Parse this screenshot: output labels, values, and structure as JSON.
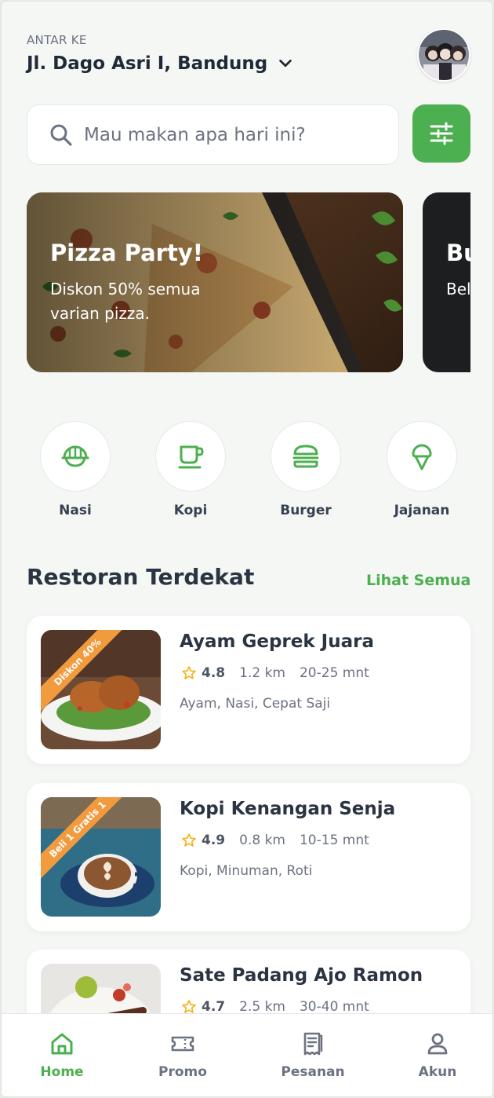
{
  "header": {
    "deliver_label": "ANTAR KE",
    "address": "Jl. Dago Asri I, Bandung"
  },
  "search": {
    "placeholder": "Mau makan apa hari ini?"
  },
  "banners": [
    {
      "title": "Pizza Party!",
      "description": "Diskon 50% semua varian pizza."
    },
    {
      "title": "Bu",
      "description": "Bel Bur"
    }
  ],
  "categories": [
    {
      "label": "Nasi",
      "icon": "rice-bowl-icon"
    },
    {
      "label": "Kopi",
      "icon": "coffee-cup-icon"
    },
    {
      "label": "Burger",
      "icon": "burger-icon"
    },
    {
      "label": "Jajanan",
      "icon": "ice-cream-icon"
    }
  ],
  "section": {
    "title": "Restoran Terdekat",
    "see_all": "Lihat Semua"
  },
  "restaurants": [
    {
      "name": "Ayam Geprek Juara",
      "rating": "4.8",
      "distance": "1.2 km",
      "eta": "20-25 mnt",
      "tags": "Ayam, Nasi, Cepat Saji",
      "promo": "Diskon 40%"
    },
    {
      "name": "Kopi Kenangan Senja",
      "rating": "4.9",
      "distance": "0.8 km",
      "eta": "10-15 mnt",
      "tags": "Kopi, Minuman, Roti",
      "promo": "Beli 1 Gratis 1"
    },
    {
      "name": "Sate Padang Ajo Ramon",
      "rating": "4.7",
      "distance": "2.5 km",
      "eta": "30-40 mnt",
      "tags": "",
      "promo": ""
    }
  ],
  "nav": [
    {
      "label": "Home",
      "icon": "home-icon",
      "active": true
    },
    {
      "label": "Promo",
      "icon": "ticket-icon",
      "active": false
    },
    {
      "label": "Pesanan",
      "icon": "receipt-icon",
      "active": false
    },
    {
      "label": "Akun",
      "icon": "user-icon",
      "active": false
    }
  ],
  "colors": {
    "primary": "#4caf50",
    "promo": "#f19a3e",
    "star": "#f5b21a",
    "text_dark": "#1f2a37"
  }
}
